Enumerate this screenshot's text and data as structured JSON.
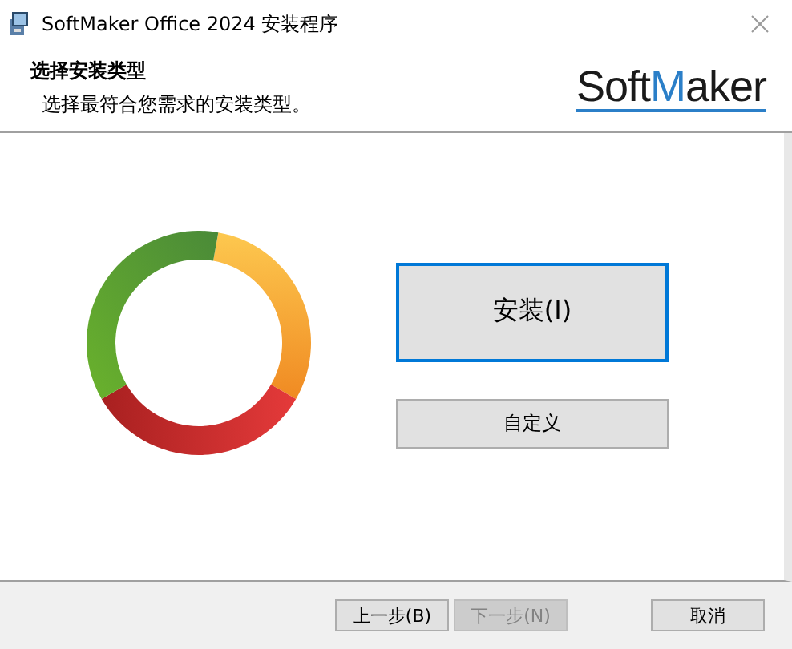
{
  "window": {
    "title": "SoftMaker Office 2024 安装程序"
  },
  "header": {
    "title": "选择安装类型",
    "subtitle": "选择最符合您需求的安装类型。",
    "logo": {
      "prefix": "Soft",
      "highlight": "M",
      "suffix": "aker"
    }
  },
  "options": [
    {
      "label": "安装(I)",
      "kind": "large",
      "focused": true
    },
    {
      "label": "自定义",
      "kind": "small",
      "focused": false
    }
  ],
  "footer_buttons": [
    {
      "label": "上一步(B)",
      "disabled": false
    },
    {
      "label": "下一步(N)",
      "disabled": true
    },
    {
      "label": "取消",
      "disabled": false
    }
  ]
}
